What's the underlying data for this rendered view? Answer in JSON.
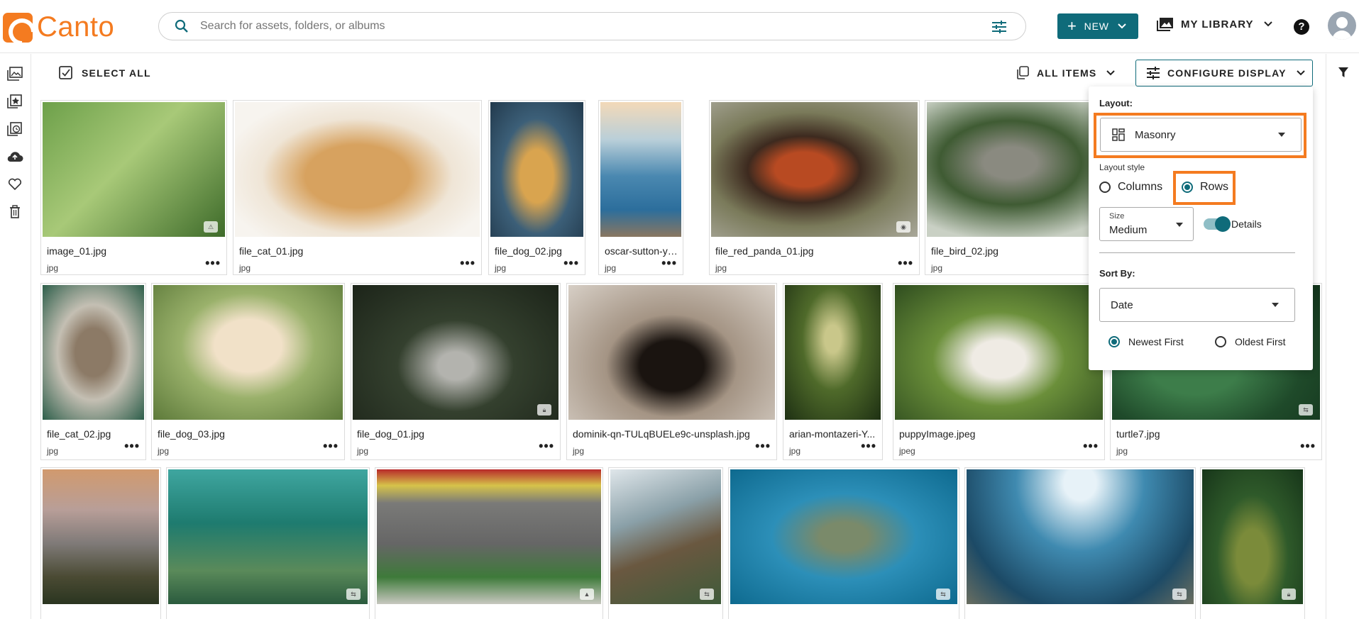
{
  "brand": {
    "name": "Canto",
    "color": "#f47b20"
  },
  "accent": "#0f6b7a",
  "search": {
    "placeholder": "Search for assets, folders, or albums"
  },
  "header": {
    "new_label": "NEW",
    "library_label": "MY LIBRARY",
    "help_label": "?"
  },
  "toolbar": {
    "select_all": "SELECT ALL",
    "all_items": "ALL ITEMS",
    "configure_display": "CONFIGURE DISPLAY"
  },
  "leftnav": [
    "library-icon",
    "collections-icon",
    "history-icon",
    "upload-icon",
    "favorites-icon",
    "trash-icon"
  ],
  "assets": [
    {
      "name": "image_01.jpg",
      "ext": "jpg",
      "badge": "warning"
    },
    {
      "name": "file_cat_01.jpg",
      "ext": "jpg"
    },
    {
      "name": "file_dog_02.jpg",
      "ext": "jpg"
    },
    {
      "name": "oscar-sutton-yihla...",
      "ext": "jpg"
    },
    {
      "name": "file_red_panda_01.jpg",
      "ext": "jpg",
      "badge": "hidden"
    },
    {
      "name": "file_bird_02.jpg",
      "ext": "jpg"
    },
    {
      "name": "file_cat_02.jpg",
      "ext": "jpg"
    },
    {
      "name": "file_dog_03.jpg",
      "ext": "jpg"
    },
    {
      "name": "file_dog_01.jpg",
      "ext": "jpg",
      "badge": "lock"
    },
    {
      "name": "dominik-qn-TULqBUELe9c-unsplash.jpg",
      "ext": "jpg"
    },
    {
      "name": "arian-montazeri-Y...",
      "ext": "jpg"
    },
    {
      "name": "puppyImage.jpeg",
      "ext": "jpeg"
    },
    {
      "name": "turtle7.jpg",
      "ext": "jpg",
      "badge": "share"
    },
    {
      "name": "",
      "ext": ""
    },
    {
      "name": "",
      "ext": "",
      "badge": "share"
    },
    {
      "name": "",
      "ext": "",
      "badge": "image"
    },
    {
      "name": "",
      "ext": "",
      "badge": "share"
    },
    {
      "name": "",
      "ext": "",
      "badge": "share"
    },
    {
      "name": "",
      "ext": "",
      "badge": "share"
    },
    {
      "name": "",
      "ext": "",
      "badge": "lock"
    }
  ],
  "config_panel": {
    "layout_label": "Layout:",
    "layout_value": "Masonry",
    "layout_style_label": "Layout style",
    "style_options": [
      "Columns",
      "Rows"
    ],
    "style_selected": "Rows",
    "size_caption": "Size",
    "size_value": "Medium",
    "details_label": "Details",
    "details_on": true,
    "sort_label": "Sort By:",
    "sort_value": "Date",
    "order_options": [
      "Newest First",
      "Oldest First"
    ],
    "order_selected": "Newest First"
  }
}
